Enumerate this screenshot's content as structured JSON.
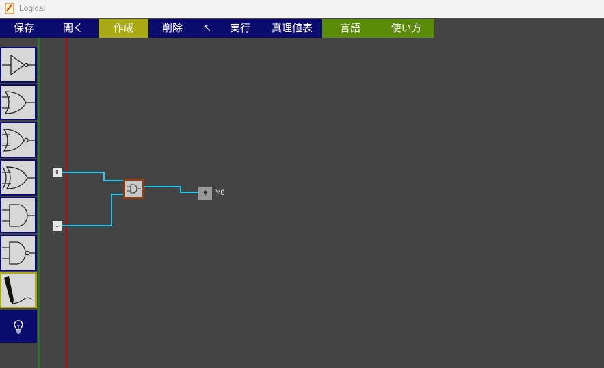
{
  "window": {
    "title": "Logical"
  },
  "menu": [
    {
      "label": "保存",
      "state": "normal"
    },
    {
      "label": "開く",
      "state": "normal"
    },
    {
      "label": "作成",
      "state": "active"
    },
    {
      "label": "削除",
      "state": "normal"
    },
    {
      "label": "↖",
      "state": "normal"
    },
    {
      "label": "実行",
      "state": "normal"
    },
    {
      "label": "真理値表",
      "state": "normal"
    },
    {
      "label": "言語",
      "state": "green"
    },
    {
      "label": "使い方",
      "state": "green"
    }
  ],
  "palette": [
    {
      "icon": "not-gate-icon"
    },
    {
      "icon": "or-gate-icon"
    },
    {
      "icon": "nor-gate-icon"
    },
    {
      "icon": "xor-gate-icon"
    },
    {
      "icon": "and-gate-icon"
    },
    {
      "icon": "nand-gate-icon"
    },
    {
      "icon": "pencil-icon",
      "selected": true
    },
    {
      "icon": "lightbulb-icon"
    }
  ],
  "circuit": {
    "inputs": [
      {
        "value": "0"
      },
      {
        "value": "1"
      }
    ],
    "gate": {
      "type": "AND",
      "icon": "and-gate-icon"
    },
    "output": {
      "label": "Y0",
      "icon": "lightbulb-icon"
    }
  },
  "colors": {
    "menu_bg": "#0c0c6e",
    "menu_active": "#aaaa14",
    "menu_green": "#5a8c0a",
    "canvas": "#444444",
    "wire": "#1ec8f0",
    "input_rail": "#c00000",
    "divider": "#0e8a10"
  }
}
